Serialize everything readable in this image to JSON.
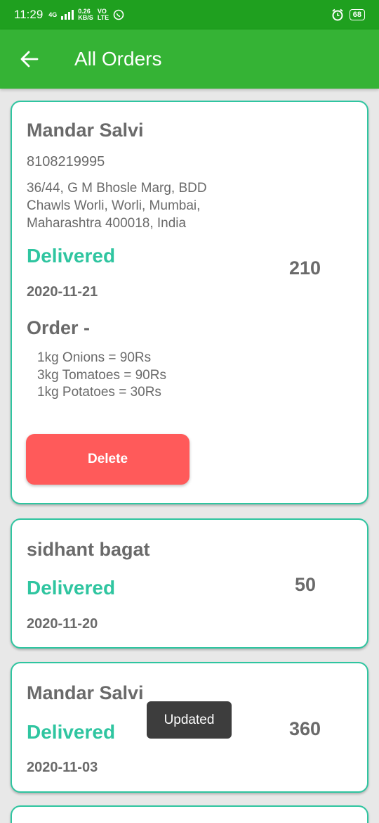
{
  "status_bar": {
    "time": "11:29",
    "network_top": "4G",
    "speed_value": "0.26",
    "speed_unit": "KB/S",
    "volte_top": "VO",
    "volte_bottom": "LTE",
    "battery": "68",
    "icons": [
      "signal-icon",
      "whatsapp-icon",
      "alarm-icon",
      "battery-icon"
    ]
  },
  "app_bar": {
    "title": "All Orders",
    "back_icon": "arrow-left-icon"
  },
  "orders": [
    {
      "name": "Mandar Salvi",
      "phone": "8108219995",
      "address": "36/44, G M Bhosle Marg, BDD Chawls Worli, Worli, Mumbai, Maharashtra 400018, India",
      "status": "Delivered",
      "amount": "210",
      "date": "2020-11-21",
      "order_heading": "Order -",
      "items": [
        "1kg Onions = 90Rs",
        "3kg Tomatoes = 90Rs",
        "1kg Potatoes = 30Rs"
      ],
      "delete_label": "Delete"
    },
    {
      "name": "sidhant bagat",
      "status": "Delivered",
      "amount": "50",
      "date": "2020-11-20"
    },
    {
      "name": "Mandar Salvi",
      "status": "Delivered",
      "amount": "360",
      "date": "2020-11-03"
    }
  ],
  "toast": "Updated",
  "colors": {
    "status_bar": "#1fa01f",
    "app_bar": "#35b335",
    "accent": "#2fc5a0",
    "delete": "#ff5a5a"
  }
}
